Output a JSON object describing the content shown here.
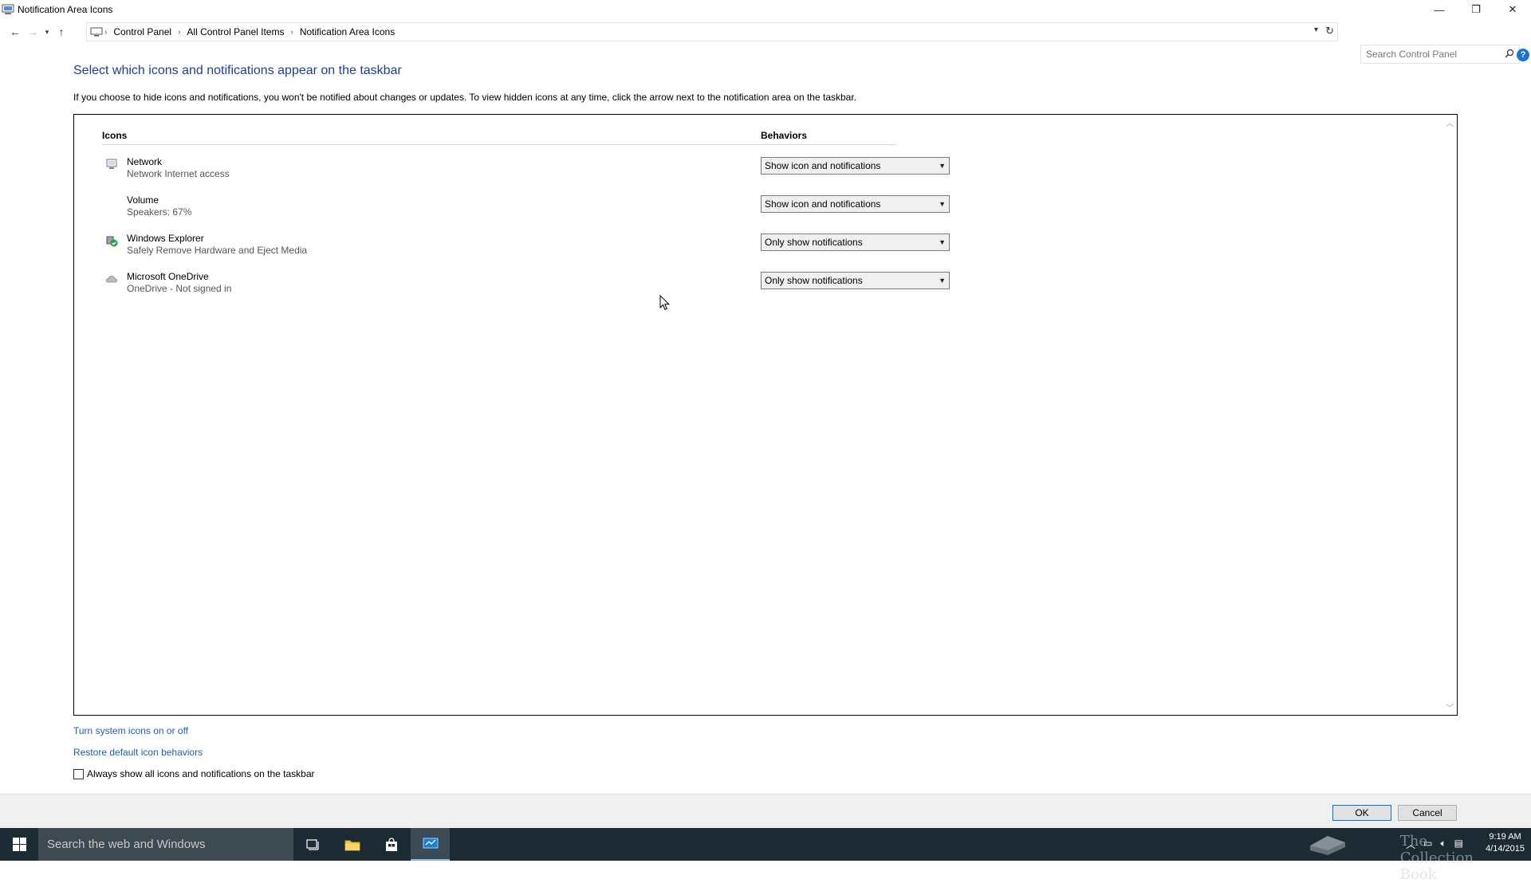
{
  "window": {
    "title": "Notification Area Icons",
    "controls": {
      "minimize": "—",
      "restore": "❐",
      "close": "✕"
    }
  },
  "navigation": {
    "breadcrumbs": [
      "Control Panel",
      "All Control Panel Items",
      "Notification Area Icons"
    ],
    "search_placeholder": "Search Control Panel"
  },
  "content": {
    "heading": "Select which icons and notifications appear on the taskbar",
    "intro": "If you choose to hide icons and notifications, you won't be notified about changes or updates. To view hidden icons at any time, click the arrow next to the notification area on the taskbar.",
    "columns": {
      "icons": "Icons",
      "behaviors": "Behaviors"
    },
    "rows": [
      {
        "name": "Network",
        "description": "Network Internet access",
        "behavior": "Show icon and notifications",
        "icon": "network-icon"
      },
      {
        "name": "Volume",
        "description": "Speakers: 67%",
        "behavior": "Show icon and notifications",
        "icon": "volume-icon"
      },
      {
        "name": "Windows Explorer",
        "description": "Safely Remove Hardware and Eject Media",
        "behavior": "Only show notifications",
        "icon": "usb-safe-remove-icon"
      },
      {
        "name": "Microsoft OneDrive",
        "description": "OneDrive - Not signed in",
        "behavior": "Only show notifications",
        "icon": "onedrive-icon"
      }
    ],
    "links": {
      "system_icons": "Turn system icons on or off",
      "restore_defaults": "Restore default icon behaviors"
    },
    "always_show_label": "Always show all icons and notifications on the taskbar",
    "always_show_checked": false
  },
  "footer": {
    "ok": "OK",
    "cancel": "Cancel"
  },
  "taskbar": {
    "search_placeholder": "Search the web and Windows",
    "watermark": "The Collection Book",
    "time": "9:19 AM",
    "date": "4/14/2015"
  },
  "colors": {
    "heading": "#1e3f99",
    "link": "#1e5fb4",
    "taskbar": "#1c2a33",
    "help": "#1a73d6"
  }
}
